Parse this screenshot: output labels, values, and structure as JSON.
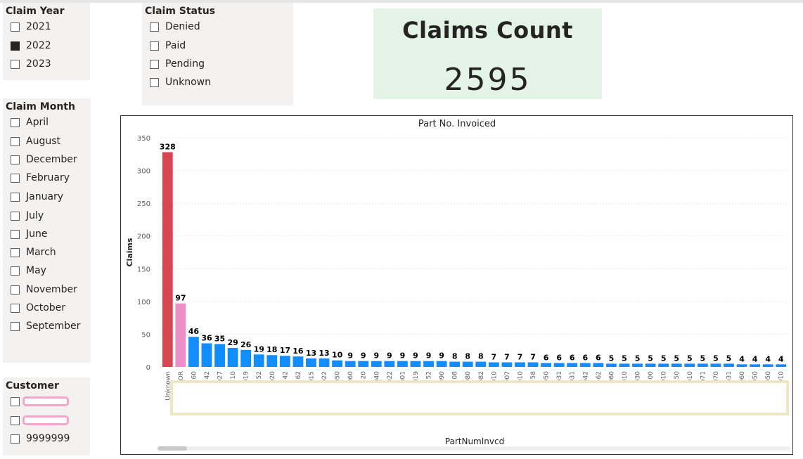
{
  "slicers": {
    "claim_year": {
      "title": "Claim Year",
      "options": [
        {
          "label": "2021",
          "checked": false
        },
        {
          "label": "2022",
          "checked": true
        },
        {
          "label": "2023",
          "checked": false
        }
      ]
    },
    "claim_status": {
      "title": "Claim Status",
      "options": [
        {
          "label": "Denied",
          "checked": false
        },
        {
          "label": "Paid",
          "checked": false
        },
        {
          "label": "Pending",
          "checked": false
        },
        {
          "label": "Unknown",
          "checked": false
        }
      ]
    },
    "claim_month": {
      "title": "Claim Month",
      "options": [
        {
          "label": "April"
        },
        {
          "label": "August"
        },
        {
          "label": "December"
        },
        {
          "label": "February"
        },
        {
          "label": "January"
        },
        {
          "label": "July"
        },
        {
          "label": "June"
        },
        {
          "label": "March"
        },
        {
          "label": "May"
        },
        {
          "label": "November"
        },
        {
          "label": "October"
        },
        {
          "label": "September"
        }
      ]
    },
    "customer": {
      "title": "Customer",
      "options": [
        {
          "label": "",
          "redacted": true
        },
        {
          "label": "",
          "redacted": true
        },
        {
          "label": "9999999",
          "redacted": false
        }
      ]
    }
  },
  "card": {
    "title": "Claims Count",
    "value": "2595",
    "background": "#e3f4e6"
  },
  "chart_data": {
    "type": "bar",
    "title": "Part No. Invoiced",
    "xlabel": "PartNumInvcd",
    "ylabel": "Claims",
    "ylim": [
      0,
      350
    ],
    "yticks": [
      0,
      50,
      100,
      150,
      200,
      250,
      300,
      350
    ],
    "grid": true,
    "categories": [
      "Unknown",
      "OR",
      "60",
      "42",
      "027",
      "10",
      "019",
      "52",
      "020",
      "42",
      "62",
      "015",
      "022",
      "050",
      "060",
      "20",
      "040",
      "022",
      "001",
      "019",
      "52",
      "090",
      "08",
      "080",
      "082",
      "010",
      "007",
      "010",
      "58",
      "050",
      "031",
      "031",
      "042",
      "62",
      "060",
      "010",
      "030",
      "00",
      "010",
      "50",
      "010",
      "071",
      "070",
      "031",
      "060",
      "050",
      "050",
      "010"
    ],
    "values": [
      328,
      97,
      46,
      36,
      35,
      29,
      26,
      19,
      18,
      17,
      16,
      13,
      13,
      10,
      9,
      9,
      9,
      9,
      9,
      9,
      9,
      9,
      8,
      8,
      8,
      7,
      7,
      7,
      7,
      6,
      6,
      6,
      6,
      6,
      5,
      5,
      5,
      5,
      5,
      5,
      5,
      5,
      5,
      5,
      4,
      4,
      4,
      4
    ],
    "colors": {
      "highlight_first": "#d64550",
      "highlight_second": "#ec8ec7",
      "default": "#118dff"
    },
    "obscured_label_box_color": "#efe6c3"
  }
}
